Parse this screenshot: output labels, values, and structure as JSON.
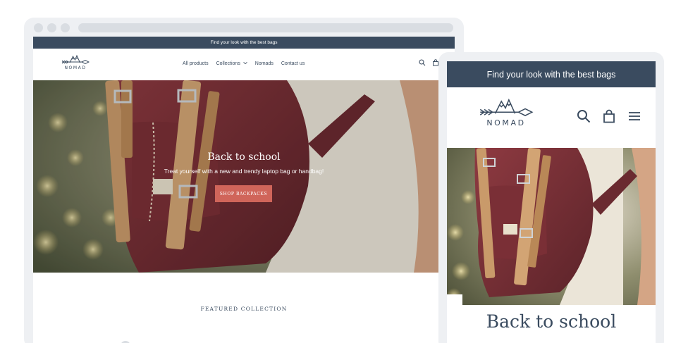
{
  "brand": {
    "name": "NOMAD",
    "colors": {
      "navy": "#3a4b5f",
      "coral": "#d0655a",
      "frame": "#eef0f3"
    }
  },
  "announcement": "Find your look with the best bags",
  "nav": {
    "items": [
      {
        "label": "All products",
        "icon": null
      },
      {
        "label": "Collections",
        "icon": "chevron-down-icon"
      },
      {
        "label": "Nomads",
        "icon": null
      },
      {
        "label": "Contact us",
        "icon": null
      }
    ],
    "header_icons": [
      "search-icon",
      "shopping-bag-icon"
    ],
    "mobile_header_icons": [
      "search-icon",
      "shopping-bag-icon",
      "hamburger-menu-icon"
    ]
  },
  "hero": {
    "title": "Back to school",
    "subtitle": "Treat yourself with a new and trendy laptop bag or handbag!",
    "button_label": "SHOP BACKPACKS"
  },
  "featured": {
    "heading": "FEATURED COLLECTION"
  }
}
